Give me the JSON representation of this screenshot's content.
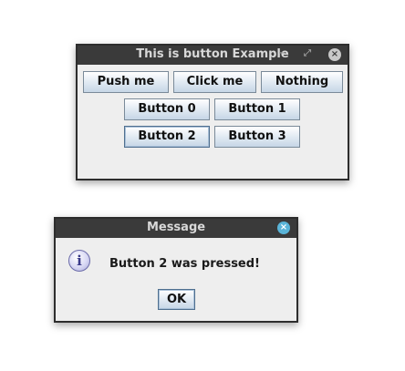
{
  "main_window": {
    "title": "This is button Example",
    "controls": {
      "minimize": "−",
      "maximize": "⤢",
      "close": "×"
    },
    "buttons": {
      "push": "Push me",
      "click": "Click me",
      "nothing": "Nothing",
      "b0": "Button 0",
      "b1": "Button 1",
      "b2": "Button 2",
      "b3": "Button 3"
    }
  },
  "dialog": {
    "title": "Message",
    "close": "×",
    "icon": "i",
    "message": "Button 2 was pressed!",
    "ok": "OK"
  },
  "colors": {
    "titlebar": "#3a3a3a",
    "close_main": "#c8c8c8",
    "close_dialog": "#5ab4d8",
    "button_border": "#7a8a99"
  }
}
